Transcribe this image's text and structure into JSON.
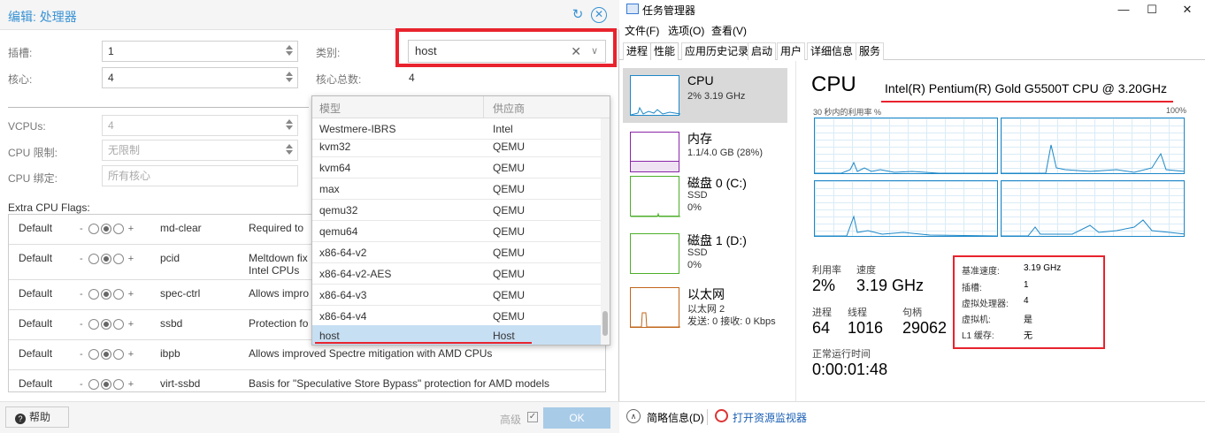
{
  "pve": {
    "title": "编辑: 处理器",
    "sockets_label": "插槽:",
    "sockets_value": "1",
    "cores_label": "核心:",
    "cores_value": "4",
    "type_label": "类别:",
    "type_value": "host",
    "total_cores_label": "核心总数:",
    "total_cores_value": "4",
    "vcpus_label": "VCPUs:",
    "vcpus_value": "4",
    "cpulimit_label": "CPU 限制:",
    "cpulimit_placeholder": "无限制",
    "cpuaffinity_label": "CPU 绑定:",
    "cpuaffinity_placeholder": "所有核心",
    "flags_label": "Extra CPU Flags:",
    "flags": [
      {
        "state": "Default",
        "name": "md-clear",
        "desc": "Required to"
      },
      {
        "state": "Default",
        "name": "pcid",
        "desc": "Meltdown fix",
        "desc2": "Intel CPUs"
      },
      {
        "state": "Default",
        "name": "spec-ctrl",
        "desc": "Allows impro"
      },
      {
        "state": "Default",
        "name": "ssbd",
        "desc": "Protection fo"
      },
      {
        "state": "Default",
        "name": "ibpb",
        "desc": "Allows improved Spectre mitigation with AMD CPUs"
      },
      {
        "state": "Default",
        "name": "virt-ssbd",
        "desc": "Basis for \"Speculative Store Bypass\" protection for AMD models"
      }
    ],
    "tri_minus": "-",
    "tri_plus": "+",
    "help_label": "帮助",
    "advanced_label": "高级",
    "ok_label": "OK",
    "dropdown": {
      "col_model": "模型",
      "col_vendor": "供应商",
      "rows": [
        {
          "model": "Westmere-IBRS",
          "vendor": "Intel"
        },
        {
          "model": "kvm32",
          "vendor": "QEMU"
        },
        {
          "model": "kvm64",
          "vendor": "QEMU"
        },
        {
          "model": "max",
          "vendor": "QEMU"
        },
        {
          "model": "qemu32",
          "vendor": "QEMU"
        },
        {
          "model": "qemu64",
          "vendor": "QEMU"
        },
        {
          "model": "x86-64-v2",
          "vendor": "QEMU"
        },
        {
          "model": "x86-64-v2-AES",
          "vendor": "QEMU"
        },
        {
          "model": "x86-64-v3",
          "vendor": "QEMU"
        },
        {
          "model": "x86-64-v4",
          "vendor": "QEMU"
        },
        {
          "model": "host",
          "vendor": "Host"
        }
      ]
    }
  },
  "tm": {
    "title": "任务管理器",
    "menu": [
      "文件(F)",
      "选项(O)",
      "查看(V)"
    ],
    "tabs": [
      "进程",
      "性能",
      "应用历史记录",
      "启动",
      "用户",
      "详细信息",
      "服务"
    ],
    "active_tab": 1,
    "sidebar": [
      {
        "name": "CPU",
        "line2": "2% 3.19 GHz",
        "line3": ""
      },
      {
        "name": "内存",
        "line2": "1.1/4.0 GB (28%)",
        "line3": ""
      },
      {
        "name": "磁盘 0 (C:)",
        "line2": "SSD",
        "line3": "0%"
      },
      {
        "name": "磁盘 1 (D:)",
        "line2": "SSD",
        "line3": "0%"
      },
      {
        "name": "以太网",
        "line2": "以太网 2",
        "line3": "发送: 0 接收: 0 Kbps"
      }
    ],
    "cpu_heading": "CPU",
    "cpu_model": "Intel(R) Pentium(R) Gold G5500T CPU @ 3.20GHz",
    "util_caption": "30 秒内的利用率 %",
    "util_max": "100%",
    "utilization_label": "利用率",
    "utilization_value": "2%",
    "speed_label": "速度",
    "speed_value": "3.19 GHz",
    "processes_label": "进程",
    "processes_value": "64",
    "threads_label": "线程",
    "threads_value": "1016",
    "handles_label": "句柄",
    "handles_value": "29062",
    "uptime_label": "正常运行时间",
    "uptime_value": "0:00:01:48",
    "specs": [
      {
        "k": "基准速度:",
        "v": "3.19 GHz"
      },
      {
        "k": "插槽:",
        "v": "1"
      },
      {
        "k": "虚拟处理器:",
        "v": "4"
      },
      {
        "k": "虚拟机:",
        "v": "是"
      },
      {
        "k": "L1 缓存:",
        "v": "无"
      }
    ],
    "fewer_details": "简略信息(D)",
    "open_resmon": "打开资源监视器",
    "colors": {
      "cpu": "#1e88c8",
      "mem": "#8b26a8",
      "disk": "#4caf2a",
      "net": "#c0661a"
    }
  }
}
